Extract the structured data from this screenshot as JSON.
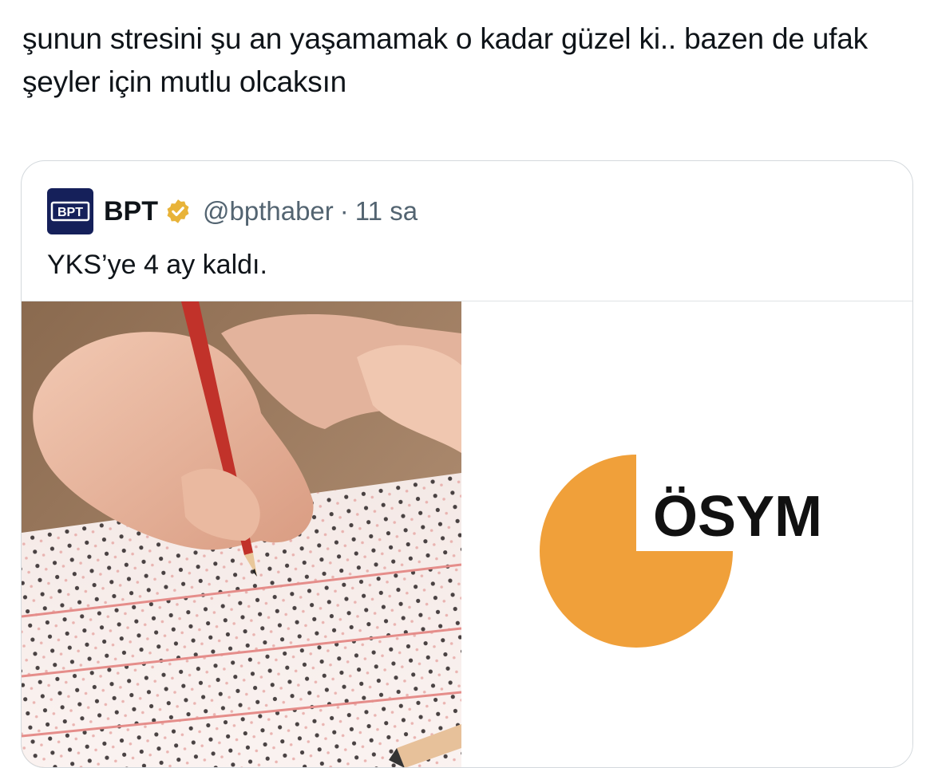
{
  "tweet": {
    "text": "şunun stresini şu an yaşamamak o kadar güzel ki.. bazen de ufak şeyler için mutlu olcaksın"
  },
  "quote": {
    "avatar_text": "BPT",
    "display_name": "BPT",
    "verified_icon": "verified-badge-icon",
    "handle": "@bpthaber",
    "separator": "·",
    "time": "11 sa",
    "text": "YKS’ye 4 ay kaldı.",
    "logo_text": "ÖSYM"
  },
  "colors": {
    "verified_gold": "#e8b339",
    "osym_orange": "#f0a03a",
    "avatar_bg": "#15205a",
    "handle_gray": "#536471",
    "pencil_red": "#c1322a"
  }
}
